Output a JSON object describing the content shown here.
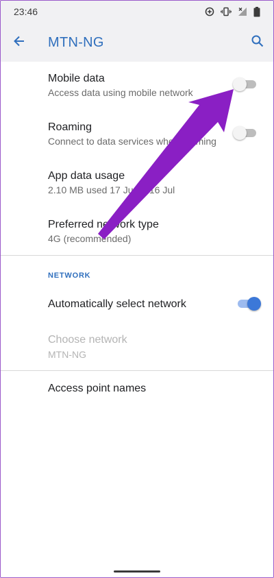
{
  "status_bar": {
    "time": "23:46",
    "icons": [
      "data-saver-icon",
      "vibrate-icon",
      "no-signal-icon",
      "battery-icon"
    ]
  },
  "app_bar": {
    "title": "MTN-NG",
    "back_icon": "arrow-back-icon",
    "search_icon": "search-icon"
  },
  "preferences": {
    "mobile_data": {
      "title": "Mobile data",
      "summary": "Access data using mobile network",
      "enabled": false
    },
    "roaming": {
      "title": "Roaming",
      "summary": "Connect to data services when roaming",
      "enabled": false
    },
    "app_data_usage": {
      "title": "App data usage",
      "summary": "2.10 MB used 17 Jun – 16 Jul"
    },
    "preferred_network": {
      "title": "Preferred network type",
      "summary": "4G (recommended)"
    }
  },
  "network_section": {
    "header": "NETWORK",
    "auto_select": {
      "title": "Automatically select network",
      "enabled": true
    },
    "choose_network": {
      "title": "Choose network",
      "summary": "MTN-NG",
      "disabled": true
    }
  },
  "access_point_names": {
    "title": "Access point names"
  },
  "colors": {
    "accent": "#2f6fbd",
    "toggle_on": "#3c78d8",
    "annotation_arrow": "#8a1fc4"
  }
}
